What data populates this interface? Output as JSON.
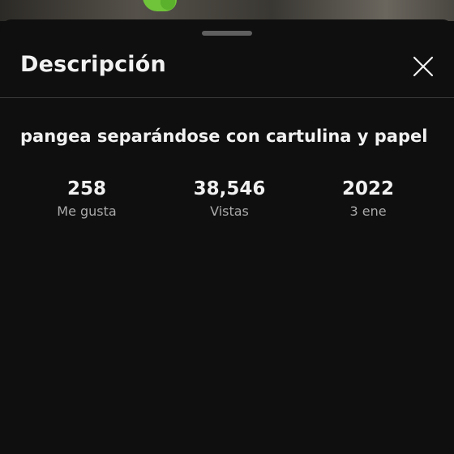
{
  "header": {
    "title": "Descripción",
    "close_icon": "close-icon"
  },
  "video": {
    "title": "pangea separándose con cartulina y papel"
  },
  "stats": [
    {
      "value": "258",
      "label": "Me gusta"
    },
    {
      "value": "38,546",
      "label": "Vistas"
    },
    {
      "value": "2022",
      "label": "3 ene"
    }
  ],
  "colors": {
    "background": "#0f0f0f",
    "text_primary": "#f1f1f1",
    "text_secondary": "#aaaaaa",
    "divider": "#3a3a3a",
    "handle": "#5f5f5f"
  }
}
